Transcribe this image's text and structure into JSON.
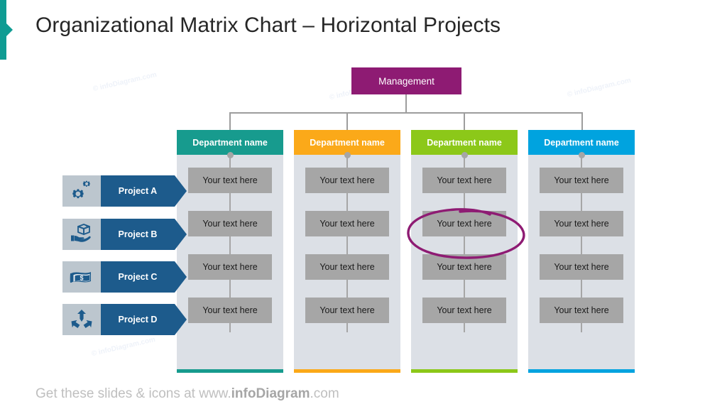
{
  "slide": {
    "title": "Organizational Matrix Chart – Horizontal Projects",
    "accent_color": "#0F9C93"
  },
  "management": {
    "label": "Management",
    "color": "#8E1B73"
  },
  "departments": [
    {
      "label": "Department name",
      "color": "#179B8E",
      "foot_color": "#179B8E"
    },
    {
      "label": "Department name",
      "color": "#FBA919",
      "foot_color": "#FBA919"
    },
    {
      "label": "Department name",
      "color": "#8CC819",
      "foot_color": "#8CC819"
    },
    {
      "label": "Department name",
      "color": "#00A3DF",
      "foot_color": "#00A3DF"
    }
  ],
  "cell_text": "Your text here",
  "projects": [
    {
      "label": "Project A",
      "icon": "gears-icon"
    },
    {
      "label": "Project B",
      "icon": "hand-holding-box-icon"
    },
    {
      "label": "Project C",
      "icon": "banknote-dollar-icon"
    },
    {
      "label": "Project D",
      "icon": "diverging-arrows-icon"
    }
  ],
  "project_colors": {
    "icon_bg": "#BCC6CE",
    "label_bg": "#1D5B8C",
    "icon_fg": "#1D5B8C"
  },
  "highlight": {
    "shape": "hand-drawn-ellipse",
    "color": "#8E1B73",
    "target_column": 3,
    "target_row": 2
  },
  "watermark": {
    "text": "© infoDiagram.com"
  },
  "footer": {
    "prefix": "Get these slides & icons at www.",
    "brand": "infoDiagram",
    "suffix": ".com"
  },
  "matrix": {
    "rows": 4,
    "columns": 4
  }
}
